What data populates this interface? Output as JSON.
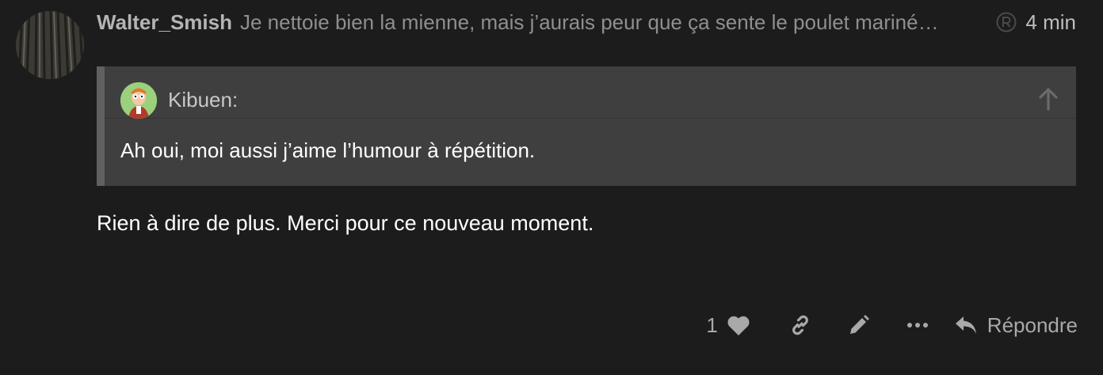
{
  "post": {
    "username": "Walter_Smish",
    "topic_excerpt": "Je nettoie bien la mienne, mais j’aurais peur que ça sente le poulet mariné…",
    "time": "4 min",
    "body": "Rien à dire de plus. Merci pour ce nouveau moment."
  },
  "quote": {
    "author": "Kibuen:",
    "text": "Ah oui, moi aussi j’aime l’humour à répétition."
  },
  "actions": {
    "like_count": "1",
    "reply_label": "Répondre"
  },
  "icons": {
    "registered": "registered-icon",
    "expand": "arrow-up-icon",
    "like": "heart-icon",
    "copy_link": "link-icon",
    "edit": "pencil-icon",
    "more": "ellipsis-icon",
    "reply": "reply-icon"
  },
  "colors": {
    "background": "#1c1c1c",
    "quote_background": "#3f3f3f",
    "quote_border": "#606060",
    "muted_text": "#a9a9a9"
  }
}
